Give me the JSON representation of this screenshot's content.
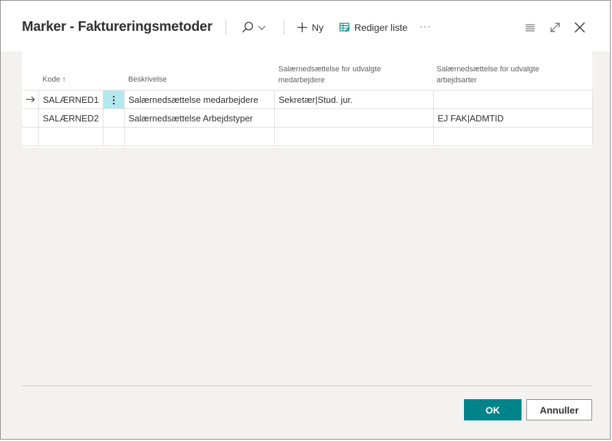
{
  "dialog": {
    "title": "Marker - Faktureringsmetoder",
    "toolbar": {
      "new_label": "Ny",
      "edit_list_label": "Rediger liste",
      "more_label": "···"
    }
  },
  "table": {
    "headers": {
      "code": "Kode ↑",
      "description": "Beskrivelse",
      "employees_line1": "Salærnedsættelse for udvalgte",
      "employees_line2": "medarbejdere",
      "worktypes_line1": "Salærnedsættelse for udvalgte",
      "worktypes_line2": "arbejdsarter"
    },
    "rows": [
      {
        "code": "SALÆRNED1",
        "description": "Salærnedsættelse medarbejdere",
        "employees": "Sekretær|Stud. jur.",
        "worktypes": ""
      },
      {
        "code": "SALÆRNED2",
        "description": "Salærnedsættelse Arbejdstyper",
        "employees": "",
        "worktypes": "EJ FAK|ADMTID"
      }
    ]
  },
  "footer": {
    "ok_label": "OK",
    "cancel_label": "Annuller"
  },
  "colors": {
    "accent": "#008489",
    "selected_cell": "#b3e9ee"
  }
}
